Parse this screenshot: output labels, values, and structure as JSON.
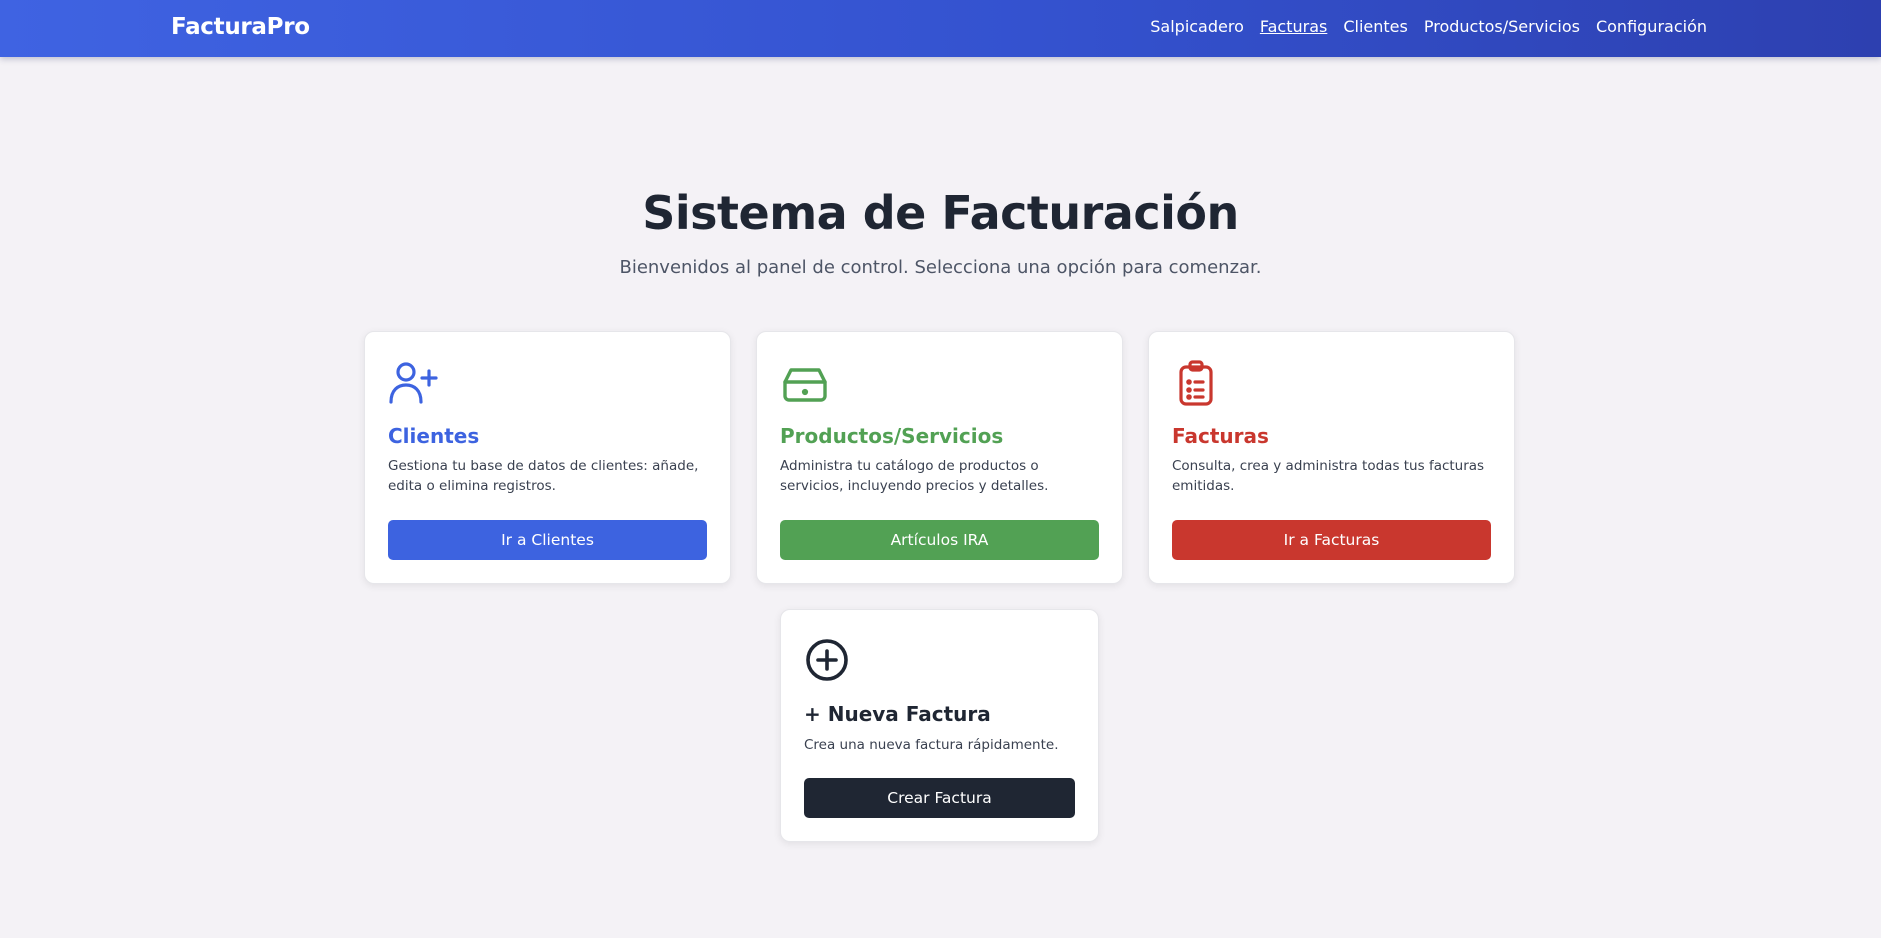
{
  "navbar": {
    "brand": "FacturaPro",
    "links": [
      {
        "label": "Salpicadero",
        "active": false
      },
      {
        "label": "Facturas",
        "active": true
      },
      {
        "label": "Clientes",
        "active": false
      },
      {
        "label": "Productos/Servicios",
        "active": false
      },
      {
        "label": "Configuración",
        "active": false
      }
    ]
  },
  "hero": {
    "title": "Sistema de Facturación",
    "subtitle": "Bienvenidos al panel de control. Selecciona una opción para comenzar."
  },
  "cards": [
    {
      "icon": "user-plus-icon",
      "title": "Clientes",
      "description": "Gestiona tu base de datos de clientes: añade, edita o elimina registros.",
      "button": "Ir a Clientes",
      "color": "#3d63e0"
    },
    {
      "icon": "inbox-icon",
      "title": "Productos/Servicios",
      "description": "Administra tu catálogo de productos o servicios, incluyendo precios y detalles.",
      "button": "Artículos IRA",
      "color": "#52a154"
    },
    {
      "icon": "clipboard-list-icon",
      "title": "Facturas",
      "description": "Consulta, crea y administra todas tus facturas emitidas.",
      "button": "Ir a Facturas",
      "color": "#c9372e"
    },
    {
      "icon": "plus-circle-icon",
      "title": "+ Nueva Factura",
      "description": "Crea una nueva factura rápidamente.",
      "button": "Crear Factura",
      "color": "#1f2633"
    }
  ]
}
